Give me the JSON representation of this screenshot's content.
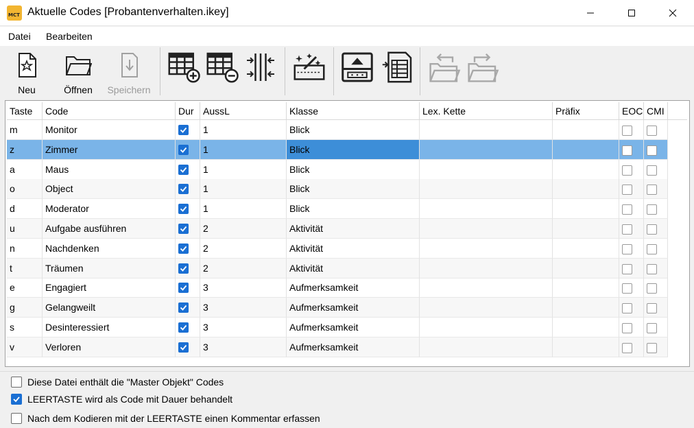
{
  "window": {
    "title": "Aktuelle Codes [Probantenverhalten.ikey]",
    "app_icon_text": "MCT"
  },
  "menu": [
    "Datei",
    "Bearbeiten"
  ],
  "toolbar": {
    "new_label": "Neu",
    "open_label": "Öffnen",
    "save_label": "Speichern",
    "icons": [
      "new-file-icon",
      "open-folder-icon",
      "save-icon",
      "add-column-grid-icon",
      "remove-column-grid-icon",
      "split-columns-icon",
      "magic-wand-icon",
      "export-icon",
      "table-list-icon",
      "import-folder-icon",
      "export-folder-icon"
    ]
  },
  "table": {
    "columns": [
      "Taste",
      "Code",
      "Dur",
      "AussL",
      "Klasse",
      "Lex. Kette",
      "Präfix",
      "EOC",
      "CMI"
    ],
    "rows": [
      {
        "taste": "m",
        "code": "Monitor",
        "dur": true,
        "aussl": "1",
        "klasse": "Blick",
        "lex": "",
        "praefix": "",
        "eoc": false,
        "cmi": false
      },
      {
        "taste": "z",
        "code": "Zimmer",
        "dur": true,
        "aussl": "1",
        "klasse": "Blick",
        "lex": "",
        "praefix": "",
        "eoc": false,
        "cmi": false,
        "selected": true
      },
      {
        "taste": "a",
        "code": "Maus",
        "dur": true,
        "aussl": "1",
        "klasse": "Blick",
        "lex": "",
        "praefix": "",
        "eoc": false,
        "cmi": false
      },
      {
        "taste": "o",
        "code": "Object",
        "dur": true,
        "aussl": "1",
        "klasse": "Blick",
        "lex": "",
        "praefix": "",
        "eoc": false,
        "cmi": false
      },
      {
        "taste": "d",
        "code": "Moderator",
        "dur": true,
        "aussl": "1",
        "klasse": "Blick",
        "lex": "",
        "praefix": "",
        "eoc": false,
        "cmi": false
      },
      {
        "taste": "u",
        "code": "Aufgabe ausführen",
        "dur": true,
        "aussl": "2",
        "klasse": "Aktivität",
        "lex": "",
        "praefix": "",
        "eoc": false,
        "cmi": false
      },
      {
        "taste": "n",
        "code": "Nachdenken",
        "dur": true,
        "aussl": "2",
        "klasse": "Aktivität",
        "lex": "",
        "praefix": "",
        "eoc": false,
        "cmi": false
      },
      {
        "taste": "t",
        "code": "Träumen",
        "dur": true,
        "aussl": "2",
        "klasse": "Aktivität",
        "lex": "",
        "praefix": "",
        "eoc": false,
        "cmi": false
      },
      {
        "taste": "e",
        "code": "Engagiert",
        "dur": true,
        "aussl": "3",
        "klasse": "Aufmerksamkeit",
        "lex": "",
        "praefix": "",
        "eoc": false,
        "cmi": false
      },
      {
        "taste": "g",
        "code": "Gelangweilt",
        "dur": true,
        "aussl": "3",
        "klasse": "Aufmerksamkeit",
        "lex": "",
        "praefix": "",
        "eoc": false,
        "cmi": false
      },
      {
        "taste": "s",
        "code": "Desinteressiert",
        "dur": true,
        "aussl": "3",
        "klasse": "Aufmerksamkeit",
        "lex": "",
        "praefix": "",
        "eoc": false,
        "cmi": false
      },
      {
        "taste": "v",
        "code": "Verloren",
        "dur": true,
        "aussl": "3",
        "klasse": "Aufmerksamkeit",
        "lex": "",
        "praefix": "",
        "eoc": false,
        "cmi": false
      }
    ]
  },
  "options": [
    {
      "label": "Diese Datei enthält die \"Master Objekt\" Codes",
      "checked": false
    },
    {
      "label": "LEERTASTE wird als Code mit Dauer behandelt",
      "checked": true
    },
    {
      "label": "Nach dem Kodieren mit der LEERTASTE einen Kommentar erfassen",
      "checked": false
    }
  ],
  "colors": {
    "accent": "#1a6fd3",
    "selection": "#7ab4e8",
    "selection_strong": "#3d8ed8"
  }
}
